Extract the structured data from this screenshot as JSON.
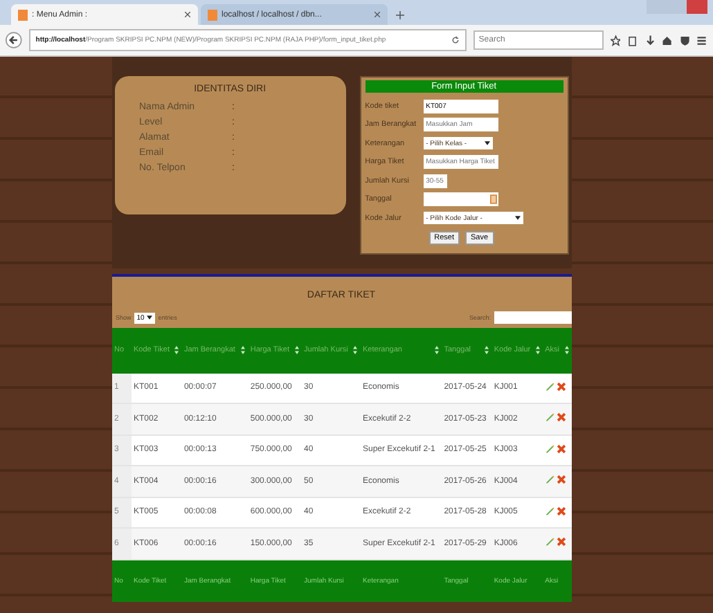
{
  "browser": {
    "tabs": [
      {
        "label": ": Menu Admin :",
        "selected": true
      },
      {
        "label": "localhost / localhost / dbn...",
        "selected": false
      }
    ],
    "url_host": "http://localhost",
    "url_path": "/Program SKRIPSI PC.NPM (NEW)/Program SKRIPSI PC.NPM (RAJA PHP)/form_input_tiket.php",
    "search": {
      "placeholder": "Search"
    }
  },
  "identity": {
    "title": "IDENTITAS DIRI",
    "fields": [
      {
        "label": "Nama Admin",
        "value": ":"
      },
      {
        "label": "Level",
        "value": ":"
      },
      {
        "label": "Alamat",
        "value": ":"
      },
      {
        "label": "Email",
        "value": ":"
      },
      {
        "label": "No. Telpon",
        "value": ":"
      }
    ]
  },
  "form": {
    "title": "Form Input Tiket",
    "fields": [
      {
        "label": "Kode tiket",
        "kind": "input",
        "value": "KT007"
      },
      {
        "label": "Jam Berangkat",
        "kind": "input",
        "placeholder": "Masukkan Jam"
      },
      {
        "label": "Keterangan",
        "kind": "select",
        "value": "- Pilih Kelas -"
      },
      {
        "label": "Harga Tiket",
        "kind": "input",
        "placeholder": "Masukkan Harga Tiket"
      },
      {
        "label": "Jumlah Kursi",
        "kind": "short",
        "placeholder": "30-55"
      },
      {
        "label": "Tanggal",
        "kind": "date"
      },
      {
        "label": "Kode Jalur",
        "kind": "wideselect",
        "value": "- Pilih Kode Jalur -"
      }
    ],
    "buttons": [
      "Reset",
      "Save"
    ]
  },
  "table": {
    "title": "DAFTAR TIKET",
    "show_label": "Show",
    "show_value": "10",
    "entries_label": "entries",
    "search_label": "Search:",
    "columns": [
      "No",
      "Kode Tiket",
      "Jam Berangkat",
      "Harga Tiket",
      "Jumlah Kursi",
      "Keterangan",
      "Tanggal",
      "Kode Jalur",
      "Aksi"
    ],
    "rows": [
      [
        "1",
        "KT001",
        "00:00:07",
        "250.000,00",
        "30",
        "Economis",
        "2017-05-24",
        "KJ001"
      ],
      [
        "2",
        "KT002",
        "00:12:10",
        "500.000,00",
        "30",
        "Excekutif 2-2",
        "2017-05-23",
        "KJ002"
      ],
      [
        "3",
        "KT003",
        "00:00:13",
        "750.000,00",
        "40",
        "Super Excekutif 2-1",
        "2017-05-25",
        "KJ003"
      ],
      [
        "4",
        "KT004",
        "00:00:16",
        "300.000,00",
        "50",
        "Economis",
        "2017-05-26",
        "KJ004"
      ],
      [
        "5",
        "KT005",
        "00:00:08",
        "600.000,00",
        "40",
        "Excekutif 2-2",
        "2017-05-28",
        "KJ005"
      ],
      [
        "6",
        "KT006",
        "00:00:16",
        "150.000,00",
        "35",
        "Super Excekutif 2-1",
        "2017-05-29",
        "KJ006"
      ]
    ],
    "footer": [
      "No",
      "Kode Tiket",
      "Jam Berangkat",
      "Harga Tiket",
      "Jumlah Kursi",
      "Keterangan",
      "Tanggal",
      "Kode Jalur",
      "Aksi"
    ]
  }
}
